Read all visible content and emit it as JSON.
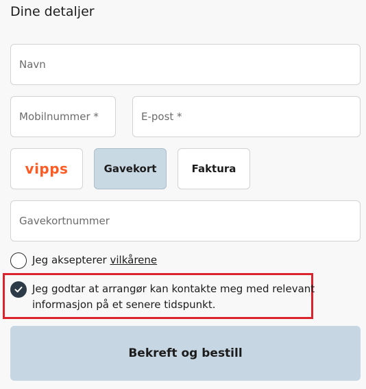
{
  "section": {
    "title": "Dine detaljer"
  },
  "fields": {
    "name_placeholder": "Navn",
    "phone_placeholder": "Mobilnummer *",
    "email_placeholder": "E-post *",
    "giftcard_placeholder": "Gavekortnummer"
  },
  "payment": {
    "vipps_label": "vipps",
    "giftcard_label": "Gavekort",
    "invoice_label": "Faktura",
    "selected": "Gavekort"
  },
  "terms": {
    "prefix": "Jeg aksepterer ",
    "link_text": "vilkårene",
    "checked": false
  },
  "consent": {
    "text": "Jeg godtar at arrangør kan kontakte meg med relevant informasjon på et senere tidspunkt.",
    "checked": true
  },
  "submit": {
    "label": "Bekreft og bestill"
  },
  "colors": {
    "vipps_brand": "#ff5b24",
    "selected_bg": "#c9d9e4",
    "submit_bg": "#c6d6e2",
    "highlight": "#d9232d",
    "checked_bg": "#2d3b48"
  },
  "icons": {
    "consent_check": "checkmark-icon"
  }
}
